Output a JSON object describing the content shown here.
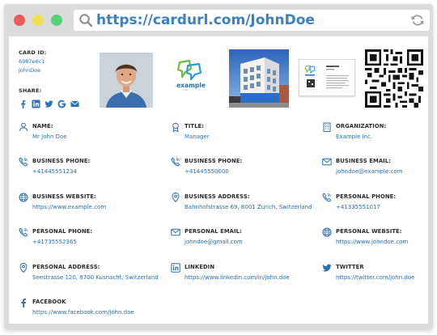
{
  "colors": {
    "accent": "#2a6fb5",
    "url_text": "#3a80c7",
    "frame": "#dcdcdc",
    "dot_red": "#ee5b5b",
    "dot_yellow": "#f3e055",
    "dot_green": "#58d27a",
    "icon": "#2a6fb5",
    "label": "#2b2b2b"
  },
  "browser": {
    "url": "https://cardurl.com/JohnDoe"
  },
  "card": {
    "id_label": "CARD ID:",
    "id_value": "6987e6c1",
    "owner": "JohnDoe",
    "share_label": "SHARE:",
    "share_icons": [
      "facebook-icon",
      "linkedin-icon",
      "twitter-icon",
      "google-icon",
      "email-icon"
    ],
    "logo_text": "example"
  },
  "fields": [
    {
      "icon": "user-icon",
      "label": "NAME:",
      "value": "Mr John Doe"
    },
    {
      "icon": "badge-icon",
      "label": "TITLE:",
      "value": "Manager"
    },
    {
      "icon": "building-icon",
      "label": "ORGANIZATION:",
      "value": "Example Inc."
    },
    {
      "icon": "phone-icon",
      "label": "BUSINESS PHONE:",
      "value": "+41445551234"
    },
    {
      "icon": "fax-icon",
      "label": "BUSINESS PHONE:",
      "value": "+41445550000"
    },
    {
      "icon": "mail-icon",
      "label": "BUSINESS EMAIL:",
      "value": "johndoe@example.com"
    },
    {
      "icon": "globe-icon",
      "label": "BUSINESS WEBSITE:",
      "value": "https://www.example.com"
    },
    {
      "icon": "pin-icon",
      "label": "BUSINESS ADDRESS:",
      "value": "Bahnhofstrasse 69, 8001 Zurich, Switzerland"
    },
    {
      "icon": "phone-icon",
      "label": "PERSONAL PHONE:",
      "value": "+41335551017"
    },
    {
      "icon": "phone-icon",
      "label": "PERSONAL PHONE:",
      "value": "+41735552365"
    },
    {
      "icon": "mail-icon",
      "label": "PERSONAL EMAIL:",
      "value": "johndoe@gmail.com"
    },
    {
      "icon": "globe-icon",
      "label": "PERSONAL WEBSITE:",
      "value": "https://www.johndoe.com"
    },
    {
      "icon": "pin-icon",
      "label": "PERSONAL ADDRESS:",
      "value": "Seestrasse 120, 8700 Kusnacht, Switzerland"
    },
    {
      "icon": "linkedin-icon",
      "label": "LINKEDIN",
      "value": "https://www.linkedin.com/in/john.doe"
    },
    {
      "icon": "twitter-icon",
      "label": "TWITTER",
      "value": "https://twitter.com/john.doe"
    },
    {
      "icon": "facebook-icon",
      "label": "FACEBOOK",
      "value": "https://www.facebook.com/john.doe"
    }
  ]
}
